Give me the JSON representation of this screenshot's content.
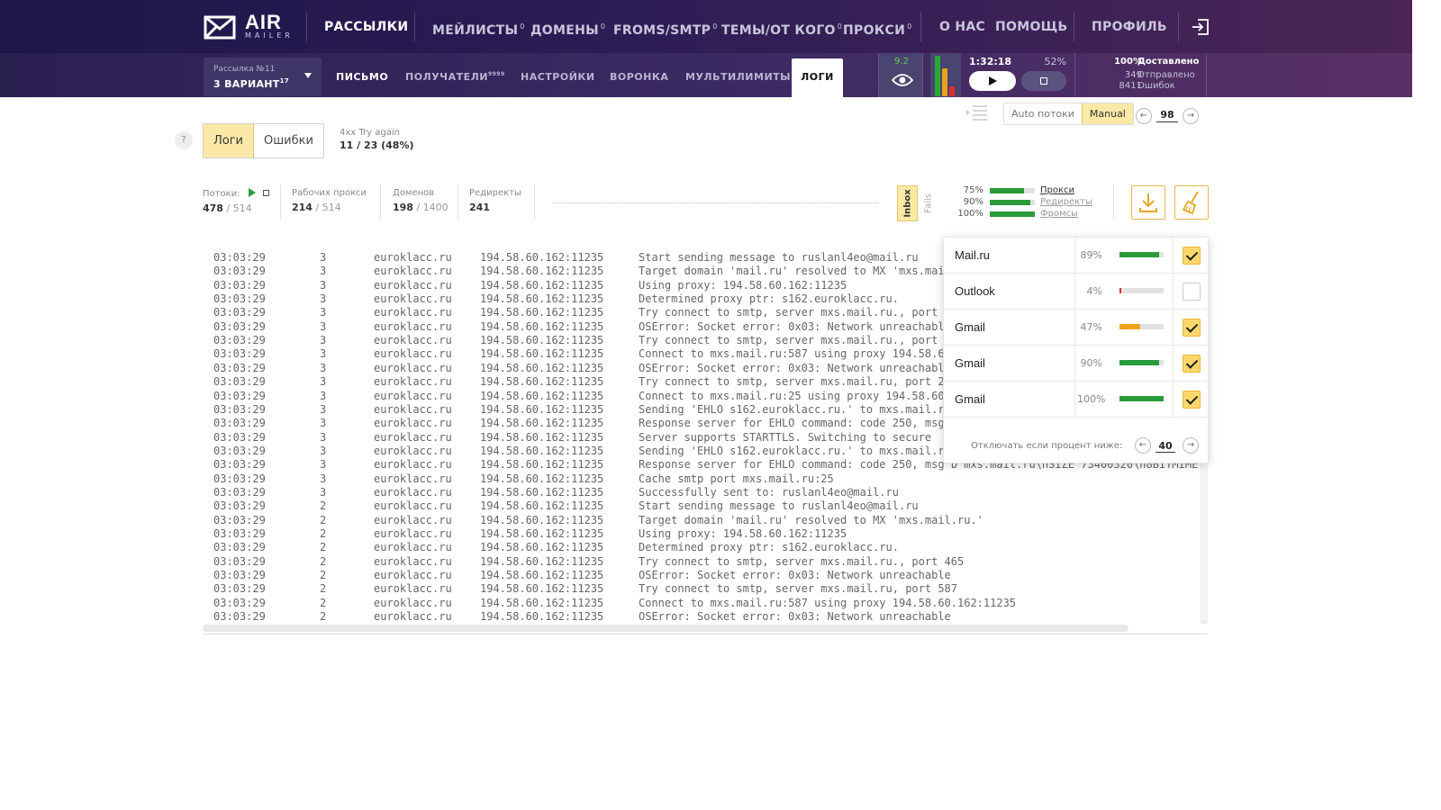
{
  "brand": {
    "air": "AIR",
    "mailer": "MAILER"
  },
  "nav": {
    "items": [
      {
        "label": "РАССЫЛКИ",
        "sup": ""
      },
      {
        "label": "МЕЙЛИСТЫ",
        "sup": "0"
      },
      {
        "label": "ДОМЕНЫ",
        "sup": "0"
      },
      {
        "label": "FROMS/SMTP",
        "sup": "0"
      },
      {
        "label": "ТЕМЫ/ОТ КОГО",
        "sup": "0"
      },
      {
        "label": "ПРОКСИ",
        "sup": "0"
      },
      {
        "label": "О НАС",
        "sup": ""
      },
      {
        "label": "ПОМОЩЬ",
        "sup": ""
      },
      {
        "label": "ПРОФИЛЬ",
        "sup": ""
      }
    ],
    "active_index": 0
  },
  "campaign": {
    "small": "Рассылка №11",
    "name": "3 ВАРИАНТ",
    "sup": "17"
  },
  "subnav": {
    "items": [
      {
        "label": "ПИСЬМО",
        "sup": ""
      },
      {
        "label": "ПОЛУЧАТЕЛИ",
        "sup": "9999"
      },
      {
        "label": "НАСТРОЙКИ",
        "sup": ""
      },
      {
        "label": "ВОРОНКА",
        "sup": ""
      },
      {
        "label": "МУЛЬТИЛИМИТЫ",
        "sup": ""
      }
    ],
    "active_tab": "ЛОГИ"
  },
  "score": "9.2",
  "level_bars": [
    {
      "color": "#2aa83a",
      "level": 1.0
    },
    {
      "color": "#e8a21c",
      "level": 0.7
    },
    {
      "color": "#d9322a",
      "level": 0.25
    }
  ],
  "timer": {
    "time": "1:32:18",
    "percent": "52%"
  },
  "delivery": [
    {
      "num": "100%",
      "label": "Доставлено"
    },
    {
      "num": "349",
      "label": "Отправлено"
    },
    {
      "num": "8411",
      "label": "Ошибок"
    }
  ],
  "threads_mode": {
    "auto": "Auto потоки",
    "manual": "Manual",
    "value": "98"
  },
  "log_tabs": {
    "logs": "Логи",
    "errors": "Ошибки"
  },
  "help": "?",
  "retry": {
    "title": "4xx Try again",
    "value": "11 / 23 (48%)"
  },
  "stats": {
    "threads": {
      "label": "Потоки:",
      "value": "478",
      "max": "/ 514"
    },
    "proxies": {
      "label": "Рабочих прокси",
      "value": "214",
      "max": "/ 514"
    },
    "domains": {
      "label": "Доменов",
      "value": "198",
      "max": "/ 1400"
    },
    "redirects": {
      "label": "Редиректы",
      "value": "241"
    }
  },
  "inbox_toggle": {
    "inbox": "Inbox",
    "fails": "Fails"
  },
  "health": [
    {
      "pct": "75%",
      "fill": 0.75,
      "label": "Прокси"
    },
    {
      "pct": "90%",
      "fill": 0.9,
      "label": "Редиректы"
    },
    {
      "pct": "100%",
      "fill": 1.0,
      "label": "Фромсы"
    }
  ],
  "log_rows": [
    {
      "time": "03:03:29",
      "thread": "3",
      "domain": "euroklacc.ru",
      "ip": "194.58.60.162:11235",
      "msg": "Start sending message to ruslanl4eo@mail.ru"
    },
    {
      "time": "03:03:29",
      "thread": "3",
      "domain": "euroklacc.ru",
      "ip": "194.58.60.162:11235",
      "msg": "Target domain 'mail.ru' resolved to MX 'mxs.mail.ru.'"
    },
    {
      "time": "03:03:29",
      "thread": "3",
      "domain": "euroklacc.ru",
      "ip": "194.58.60.162:11235",
      "msg": "Using proxy: 194.58.60.162:11235"
    },
    {
      "time": "03:03:29",
      "thread": "3",
      "domain": "euroklacc.ru",
      "ip": "194.58.60.162:11235",
      "msg": "Determined proxy ptr: s162.euroklacc.ru."
    },
    {
      "time": "03:03:29",
      "thread": "3",
      "domain": "euroklacc.ru",
      "ip": "194.58.60.162:11235",
      "msg": "Try connect to smtp, server mxs.mail.ru., port 465"
    },
    {
      "time": "03:03:29",
      "thread": "3",
      "domain": "euroklacc.ru",
      "ip": "194.58.60.162:11235",
      "msg": "OSError: Socket error: 0x03: Network unreachable"
    },
    {
      "time": "03:03:29",
      "thread": "3",
      "domain": "euroklacc.ru",
      "ip": "194.58.60.162:11235",
      "msg": "Try connect to smtp, server mxs.mail.ru., port 587"
    },
    {
      "time": "03:03:29",
      "thread": "3",
      "domain": "euroklacc.ru",
      "ip": "194.58.60.162:11235",
      "msg": "Connect to mxs.mail.ru:587 using proxy 194.58.60.162:11235"
    },
    {
      "time": "03:03:29",
      "thread": "3",
      "domain": "euroklacc.ru",
      "ip": "194.58.60.162:11235",
      "msg": "OSError: Socket error: 0x03: Network unreachable"
    },
    {
      "time": "03:03:29",
      "thread": "3",
      "domain": "euroklacc.ru",
      "ip": "194.58.60.162:11235",
      "msg": "Try connect to smtp, server mxs.mail.ru, port 25"
    },
    {
      "time": "03:03:29",
      "thread": "3",
      "domain": "euroklacc.ru",
      "ip": "194.58.60.162:11235",
      "msg": "Connect to mxs.mail.ru:25 using proxy 194.58.60.162:11235"
    },
    {
      "time": "03:03:29",
      "thread": "3",
      "domain": "euroklacc.ru",
      "ip": "194.58.60.162:11235",
      "msg": "Sending 'EHLO s162.euroklacc.ru.' to mxs.mail.ru"
    },
    {
      "time": "03:03:29",
      "thread": "3",
      "domain": "euroklacc.ru",
      "ip": "194.58.60.162:11235",
      "msg": "Response server for EHLO command: code 250, msg"
    },
    {
      "time": "03:03:29",
      "thread": "3",
      "domain": "euroklacc.ru",
      "ip": "194.58.60.162:11235",
      "msg": "Server supports STARTTLS. Switching to secure"
    },
    {
      "time": "03:03:29",
      "thread": "3",
      "domain": "euroklacc.ru",
      "ip": "194.58.60.162:11235",
      "msg": "Sending 'EHLO s162.euroklacc.ru.' to mxs.mail.ru"
    },
    {
      "time": "03:03:29",
      "thread": "3",
      "domain": "euroklacc.ru",
      "ip": "194.58.60.162:11235",
      "msg": "Response server for EHLO command: code 250, msg b'mxs.mail.ru\\nSIZE 73400320\\n8BITMIME'"
    },
    {
      "time": "03:03:29",
      "thread": "3",
      "domain": "euroklacc.ru",
      "ip": "194.58.60.162:11235",
      "msg": "Cache smtp port mxs.mail.ru:25"
    },
    {
      "time": "03:03:29",
      "thread": "3",
      "domain": "euroklacc.ru",
      "ip": "194.58.60.162:11235",
      "msg": "Successfully sent to: ruslanl4eo@mail.ru"
    },
    {
      "time": "03:03:29",
      "thread": "2",
      "domain": "euroklacc.ru",
      "ip": "194.58.60.162:11235",
      "msg": "Start sending message to ruslanl4eo@mail.ru"
    },
    {
      "time": "03:03:29",
      "thread": "2",
      "domain": "euroklacc.ru",
      "ip": "194.58.60.162:11235",
      "msg": "Target domain 'mail.ru' resolved to MX 'mxs.mail.ru.'"
    },
    {
      "time": "03:03:29",
      "thread": "2",
      "domain": "euroklacc.ru",
      "ip": "194.58.60.162:11235",
      "msg": "Using proxy: 194.58.60.162:11235"
    },
    {
      "time": "03:03:29",
      "thread": "2",
      "domain": "euroklacc.ru",
      "ip": "194.58.60.162:11235",
      "msg": "Determined proxy ptr: s162.euroklacc.ru."
    },
    {
      "time": "03:03:29",
      "thread": "2",
      "domain": "euroklacc.ru",
      "ip": "194.58.60.162:11235",
      "msg": "Try connect to smtp, server mxs.mail.ru., port 465"
    },
    {
      "time": "03:03:29",
      "thread": "2",
      "domain": "euroklacc.ru",
      "ip": "194.58.60.162:11235",
      "msg": "OSError: Socket error: 0x03: Network unreachable"
    },
    {
      "time": "03:03:29",
      "thread": "2",
      "domain": "euroklacc.ru",
      "ip": "194.58.60.162:11235",
      "msg": "Try connect to smtp, server mxs.mail.ru, port 587"
    },
    {
      "time": "03:03:29",
      "thread": "2",
      "domain": "euroklacc.ru",
      "ip": "194.58.60.162:11235",
      "msg": "Connect to mxs.mail.ru:587 using proxy 194.58.60.162:11235"
    },
    {
      "time": "03:03:29",
      "thread": "2",
      "domain": "euroklacc.ru",
      "ip": "194.58.60.162:11235",
      "msg": "OSError: Socket error: 0x03: Network unreachable"
    }
  ],
  "popup": {
    "rows": [
      {
        "name": "Mail.ru",
        "pct": "89%",
        "fill": 0.89,
        "color": "#2a9b3b",
        "checked": true
      },
      {
        "name": "Outlook",
        "pct": "4%",
        "fill": 0.04,
        "color": "#d9322a",
        "checked": false
      },
      {
        "name": "Gmail",
        "pct": "47%",
        "fill": 0.47,
        "color": "#f0a21c",
        "checked": true
      },
      {
        "name": "Gmail",
        "pct": "90%",
        "fill": 0.9,
        "color": "#2a9b3b",
        "checked": true
      },
      {
        "name": "Gmail",
        "pct": "100%",
        "fill": 1.0,
        "color": "#2a9b3b",
        "checked": true
      }
    ],
    "footer_text": "Отключать если процент ниже:",
    "threshold": "40"
  }
}
